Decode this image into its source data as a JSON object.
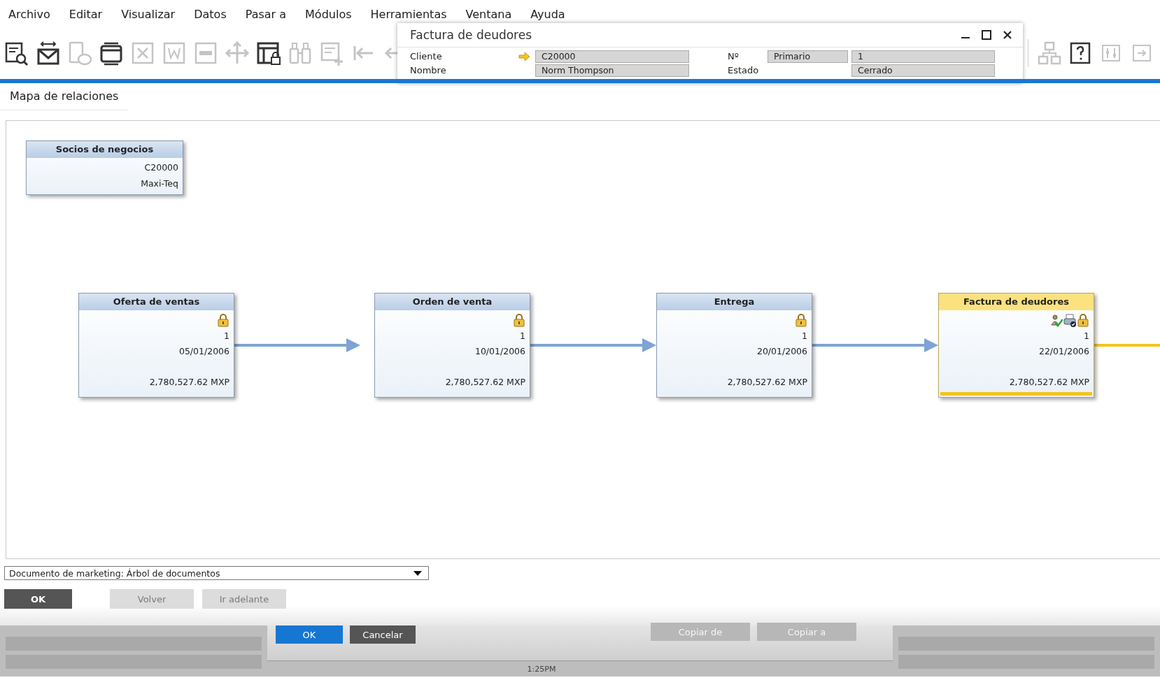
{
  "menu": [
    {
      "label": "Archivo"
    },
    {
      "label": "Editar"
    },
    {
      "label": "Visualizar"
    },
    {
      "label": "Datos"
    },
    {
      "label": "Pasar a"
    },
    {
      "label": "Módulos"
    },
    {
      "label": "Herramientas"
    },
    {
      "label": "Ventana"
    },
    {
      "label": "Ayuda"
    }
  ],
  "toolbar_left": [
    {
      "kind": "preview",
      "disabled": false
    },
    {
      "kind": "mail",
      "disabled": false
    },
    {
      "kind": "message",
      "disabled": true
    },
    {
      "kind": "windows",
      "disabled": false
    },
    {
      "kind": "excel",
      "disabled": true
    },
    {
      "kind": "word",
      "disabled": true
    },
    {
      "kind": "pdf",
      "disabled": true
    },
    {
      "kind": "move",
      "disabled": true
    },
    {
      "kind": "layout",
      "disabled": false
    },
    {
      "kind": "binoculars",
      "disabled": true
    },
    {
      "kind": "add",
      "disabled": true
    },
    {
      "kind": "first",
      "disabled": true
    },
    {
      "kind": "back",
      "disabled": true
    }
  ],
  "toolbar_right": [
    {
      "kind": "tree",
      "disabled": true
    },
    {
      "kind": "help",
      "disabled": false
    },
    {
      "kind": "settings",
      "disabled": true
    },
    {
      "kind": "export",
      "disabled": true
    }
  ],
  "dialog": {
    "title": "Factura de deudores",
    "left_fields": [
      {
        "label": "Cliente",
        "value": "C20000",
        "link": true
      },
      {
        "label": "Nombre",
        "value": "Norm Thompson",
        "link": false
      }
    ],
    "number": {
      "label": "Nº",
      "series": "Primario",
      "value": "1"
    },
    "status": {
      "label": "Estado",
      "value": "Cerrado"
    }
  },
  "panel_title": "Mapa de relaciones",
  "map": {
    "root": {
      "title": "Socios de negocios",
      "lines": [
        "C20000",
        "Maxi-Teq"
      ]
    },
    "flow": [
      {
        "kind": "node",
        "title": "Oferta de ventas",
        "selected": false,
        "approved": false,
        "printed": false,
        "locked": true,
        "number": "1",
        "date": "05/01/2006",
        "amount": "2,780,527.62 MXP"
      },
      {
        "kind": "arrow"
      },
      {
        "kind": "node",
        "title": "Orden de venta",
        "selected": false,
        "approved": false,
        "printed": false,
        "locked": true,
        "number": "1",
        "date": "10/01/2006",
        "amount": "2,780,527.62 MXP"
      },
      {
        "kind": "arrow"
      },
      {
        "kind": "node",
        "title": "Entrega",
        "selected": false,
        "approved": false,
        "printed": false,
        "locked": true,
        "number": "1",
        "date": "20/01/2006",
        "amount": "2,780,527.62 MXP"
      },
      {
        "kind": "arrow"
      },
      {
        "kind": "node",
        "title": "Factura de deudores",
        "selected": true,
        "approved": true,
        "printed": true,
        "locked": true,
        "number": "1",
        "date": "22/01/2006",
        "amount": "2,780,527.62 MXP"
      },
      {
        "kind": "line",
        "selected": true
      }
    ]
  },
  "view_select": {
    "value": "Documento de marketing: Árbol de documentos"
  },
  "buttons": [
    {
      "label": "OK",
      "disabled": false
    },
    {
      "label": "Volver",
      "disabled": true
    },
    {
      "label": "Ir adelante",
      "disabled": true
    }
  ],
  "background_window": {
    "buttons": [
      {
        "label": "OK",
        "kind": "primary"
      },
      {
        "label": "Cancelar",
        "kind": "secondary"
      },
      {
        "label": "Copiar de",
        "kind": "disabled"
      },
      {
        "label": "Copiar a",
        "kind": "disabled"
      }
    ],
    "time": "1:25PM"
  }
}
